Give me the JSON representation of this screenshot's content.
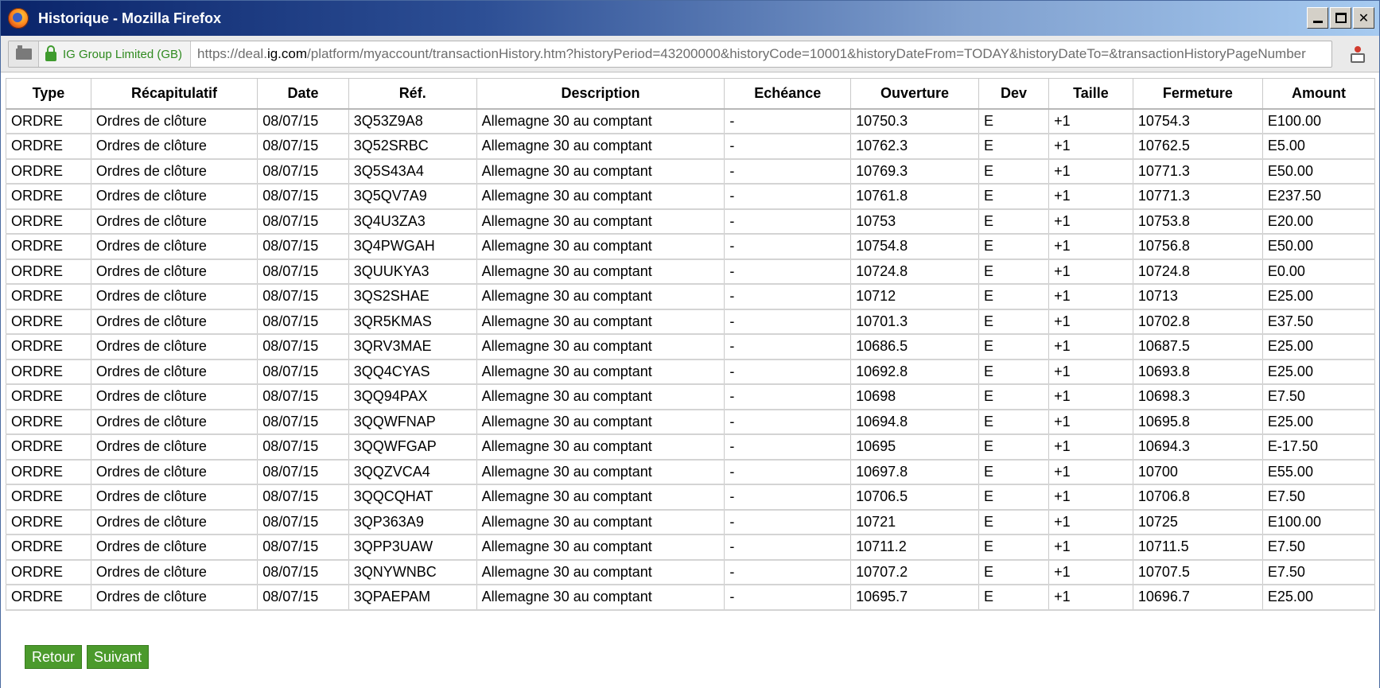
{
  "window": {
    "title": "Historique - Mozilla Firefox"
  },
  "addressbar": {
    "identity": "IG Group Limited (GB)",
    "url_scheme": "https://deal.",
    "url_host": "ig.com",
    "url_rest": "/platform/myaccount/transactionHistory.htm?historyPeriod=43200000&historyCode=10001&historyDateFrom=TODAY&historyDateTo=&transactionHistoryPageNumber"
  },
  "table": {
    "headers": [
      "Type",
      "Récapitulatif",
      "Date",
      "Réf.",
      "Description",
      "Echéance",
      "Ouverture",
      "Dev",
      "Taille",
      "Fermeture",
      "Amount"
    ],
    "rows": [
      [
        "ORDRE",
        "Ordres de clôture",
        "08/07/15",
        "3Q53Z9A8",
        "Allemagne 30 au comptant",
        "-",
        "10750.3",
        "E",
        "+1",
        "10754.3",
        "E100.00"
      ],
      [
        "ORDRE",
        "Ordres de clôture",
        "08/07/15",
        "3Q52SRBC",
        "Allemagne 30 au comptant",
        "-",
        "10762.3",
        "E",
        "+1",
        "10762.5",
        "E5.00"
      ],
      [
        "ORDRE",
        "Ordres de clôture",
        "08/07/15",
        "3Q5S43A4",
        "Allemagne 30 au comptant",
        "-",
        "10769.3",
        "E",
        "+1",
        "10771.3",
        "E50.00"
      ],
      [
        "ORDRE",
        "Ordres de clôture",
        "08/07/15",
        "3Q5QV7A9",
        "Allemagne 30 au comptant",
        "-",
        "10761.8",
        "E",
        "+1",
        "10771.3",
        "E237.50"
      ],
      [
        "ORDRE",
        "Ordres de clôture",
        "08/07/15",
        "3Q4U3ZA3",
        "Allemagne 30 au comptant",
        "-",
        "10753",
        "E",
        "+1",
        "10753.8",
        "E20.00"
      ],
      [
        "ORDRE",
        "Ordres de clôture",
        "08/07/15",
        "3Q4PWGAH",
        "Allemagne 30 au comptant",
        "-",
        "10754.8",
        "E",
        "+1",
        "10756.8",
        "E50.00"
      ],
      [
        "ORDRE",
        "Ordres de clôture",
        "08/07/15",
        "3QUUKYA3",
        "Allemagne 30 au comptant",
        "-",
        "10724.8",
        "E",
        "+1",
        "10724.8",
        "E0.00"
      ],
      [
        "ORDRE",
        "Ordres de clôture",
        "08/07/15",
        "3QS2SHAE",
        "Allemagne 30 au comptant",
        "-",
        "10712",
        "E",
        "+1",
        "10713",
        "E25.00"
      ],
      [
        "ORDRE",
        "Ordres de clôture",
        "08/07/15",
        "3QR5KMAS",
        "Allemagne 30 au comptant",
        "-",
        "10701.3",
        "E",
        "+1",
        "10702.8",
        "E37.50"
      ],
      [
        "ORDRE",
        "Ordres de clôture",
        "08/07/15",
        "3QRV3MAE",
        "Allemagne 30 au comptant",
        "-",
        "10686.5",
        "E",
        "+1",
        "10687.5",
        "E25.00"
      ],
      [
        "ORDRE",
        "Ordres de clôture",
        "08/07/15",
        "3QQ4CYAS",
        "Allemagne 30 au comptant",
        "-",
        "10692.8",
        "E",
        "+1",
        "10693.8",
        "E25.00"
      ],
      [
        "ORDRE",
        "Ordres de clôture",
        "08/07/15",
        "3QQ94PAX",
        "Allemagne 30 au comptant",
        "-",
        "10698",
        "E",
        "+1",
        "10698.3",
        "E7.50"
      ],
      [
        "ORDRE",
        "Ordres de clôture",
        "08/07/15",
        "3QQWFNAP",
        "Allemagne 30 au comptant",
        "-",
        "10694.8",
        "E",
        "+1",
        "10695.8",
        "E25.00"
      ],
      [
        "ORDRE",
        "Ordres de clôture",
        "08/07/15",
        "3QQWFGAP",
        "Allemagne 30 au comptant",
        "-",
        "10695",
        "E",
        "+1",
        "10694.3",
        "E-17.50"
      ],
      [
        "ORDRE",
        "Ordres de clôture",
        "08/07/15",
        "3QQZVCA4",
        "Allemagne 30 au comptant",
        "-",
        "10697.8",
        "E",
        "+1",
        "10700",
        "E55.00"
      ],
      [
        "ORDRE",
        "Ordres de clôture",
        "08/07/15",
        "3QQCQHAT",
        "Allemagne 30 au comptant",
        "-",
        "10706.5",
        "E",
        "+1",
        "10706.8",
        "E7.50"
      ],
      [
        "ORDRE",
        "Ordres de clôture",
        "08/07/15",
        "3QP363A9",
        "Allemagne 30 au comptant",
        "-",
        "10721",
        "E",
        "+1",
        "10725",
        "E100.00"
      ],
      [
        "ORDRE",
        "Ordres de clôture",
        "08/07/15",
        "3QPP3UAW",
        "Allemagne 30 au comptant",
        "-",
        "10711.2",
        "E",
        "+1",
        "10711.5",
        "E7.50"
      ],
      [
        "ORDRE",
        "Ordres de clôture",
        "08/07/15",
        "3QNYWNBC",
        "Allemagne 30 au comptant",
        "-",
        "10707.2",
        "E",
        "+1",
        "10707.5",
        "E7.50"
      ],
      [
        "ORDRE",
        "Ordres de clôture",
        "08/07/15",
        "3QPAEPAM",
        "Allemagne 30 au comptant",
        "-",
        "10695.7",
        "E",
        "+1",
        "10696.7",
        "E25.00"
      ]
    ]
  },
  "buttons": {
    "back_label": "Retour",
    "next_label": "Suivant"
  },
  "colors": {
    "button_green": "#4b9a2c",
    "identity_green": "#2f8a1f",
    "titlebar_dark": "#0a246a"
  }
}
